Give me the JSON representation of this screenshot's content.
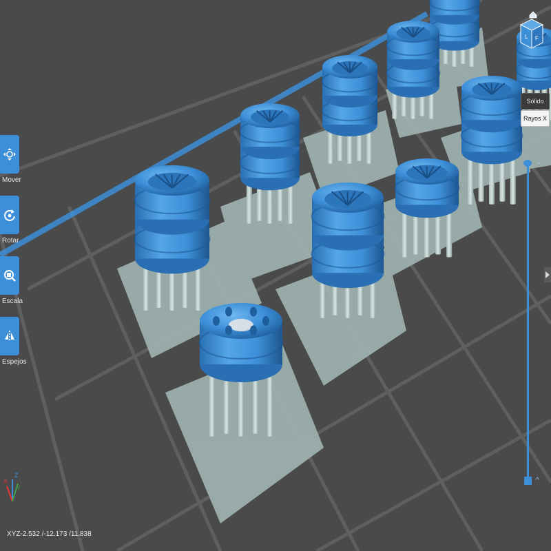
{
  "tools": [
    {
      "id": "move",
      "label": "Mover",
      "icon": "move-icon"
    },
    {
      "id": "rotate",
      "label": "Rotar",
      "icon": "rotate-icon"
    },
    {
      "id": "scale",
      "label": "Escala",
      "icon": "scale-icon"
    },
    {
      "id": "mirror",
      "label": "Espejos",
      "icon": "mirror-icon"
    }
  ],
  "view_modes": {
    "solid": "Sólido",
    "xray": "Rayos X"
  },
  "status": {
    "coordinates": "XYZ-2.532 /-12.173 /11.838"
  },
  "axes": {
    "x": "X",
    "y": "Y",
    "z": "Z"
  },
  "colors": {
    "model": "#3d8fd8",
    "support_pad": "#9fb3b0",
    "bed": "#4a4a4a",
    "grid": "#5e5e5e",
    "accent": "#3d8fd8"
  },
  "slider": {
    "up_icon": "chevron-up-icon",
    "down_icon": "chevron-down-icon"
  }
}
